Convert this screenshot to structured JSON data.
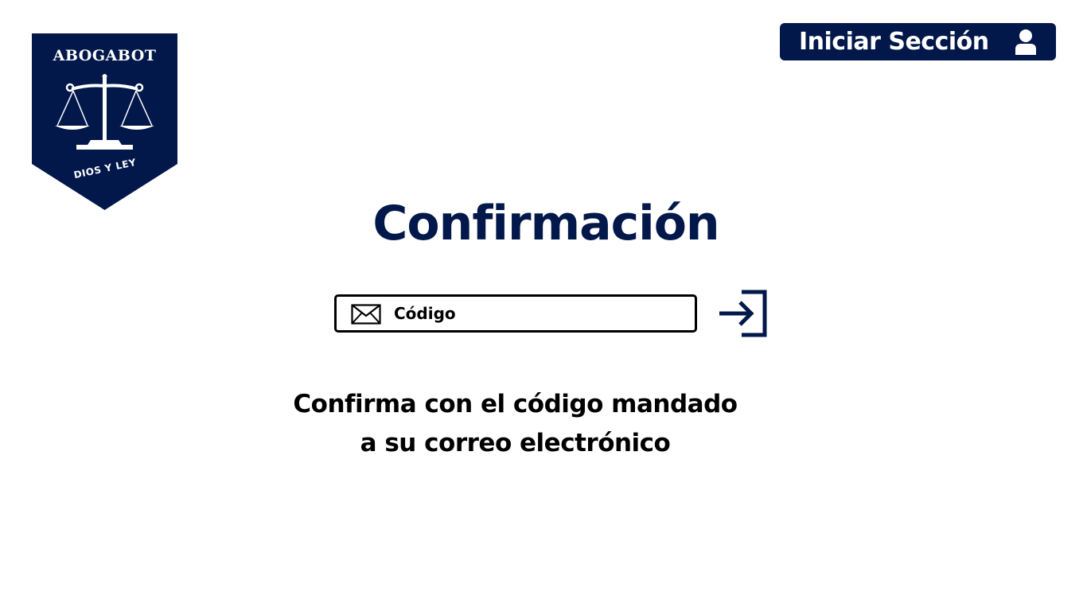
{
  "logo": {
    "title": "ABOGABOT",
    "motto": "DIOS Y LEY",
    "icon": "scales-of-justice-icon",
    "color": "#02174a"
  },
  "header": {
    "login_label": "Iniciar Sección",
    "login_icon": "user-icon"
  },
  "main": {
    "title": "Confirmación",
    "code_field": {
      "placeholder": "Código",
      "value": "",
      "icon": "envelope-icon"
    },
    "submit_icon": "sign-in-icon",
    "message_line1": "Confirma con el código mandado",
    "message_line2": "a su correo electrónico"
  },
  "colors": {
    "brand": "#02174a",
    "text": "#000000",
    "background": "#ffffff"
  }
}
